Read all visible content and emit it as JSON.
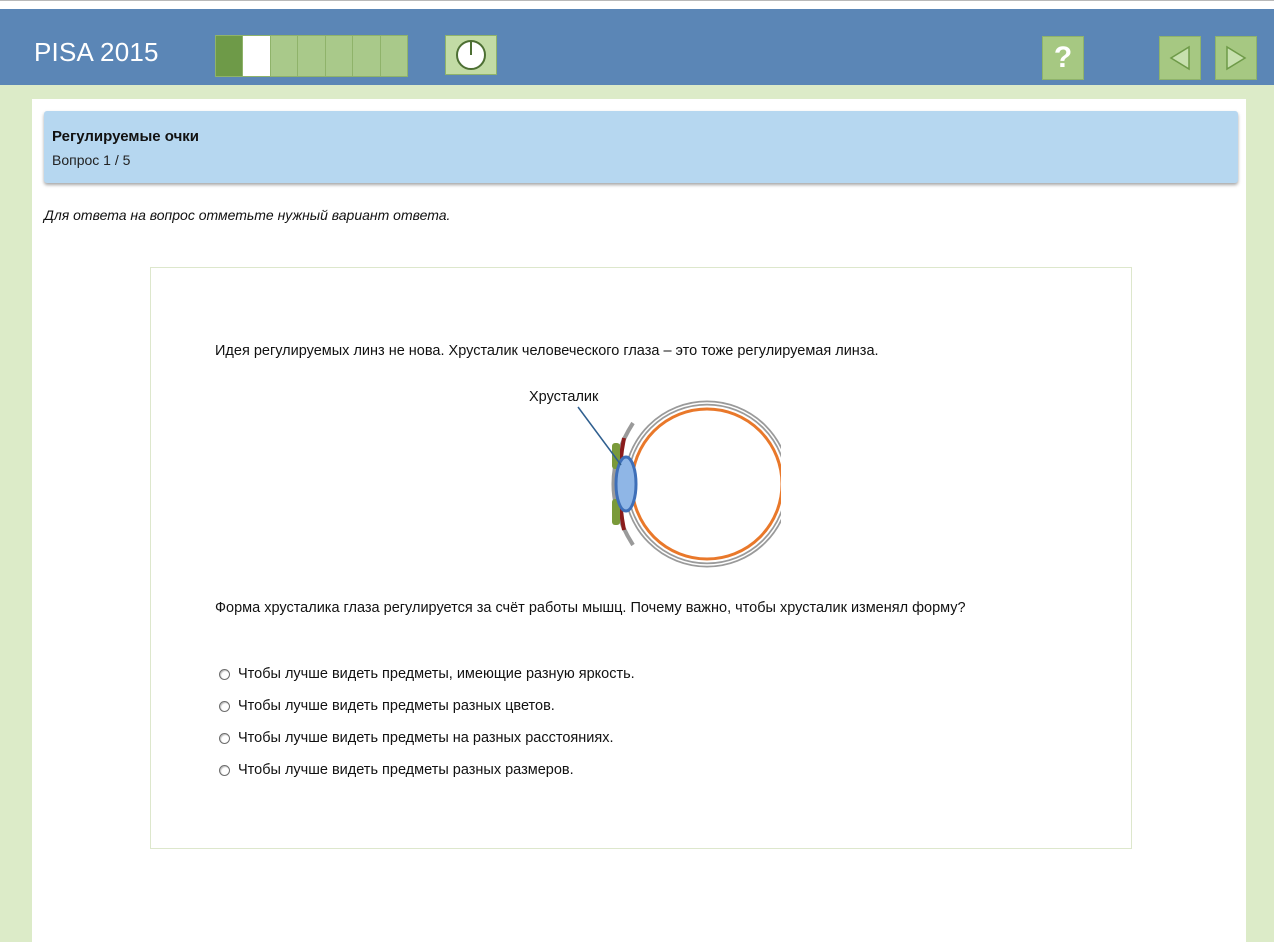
{
  "header": {
    "logo": "PISA 2015",
    "progress": {
      "segments": 7,
      "completed": 1,
      "current": 2
    },
    "timer_icon": "clock-icon",
    "help_label": "?",
    "nav": {
      "prev_icon": "arrow-left-icon",
      "next_icon": "arrow-right-icon"
    }
  },
  "unit": {
    "title": "Регулируемые очки",
    "question_number": "Вопрос 1 / 5"
  },
  "instruction": "Для ответа на вопрос отметьте нужный вариант ответа.",
  "content": {
    "intro": "Идея регулируемых линз не нова. Хрусталик человеческого глаза – это тоже регулируемая линза.",
    "figure": {
      "label": "Хрусталик"
    },
    "question": "Форма хрусталика глаза регулируется за счёт работы мышц. Почему важно, чтобы хрусталик изменял форму?",
    "options": [
      "Чтобы лучше видеть предметы, имеющие разную яркость.",
      "Чтобы лучше видеть предметы разных цветов.",
      "Чтобы лучше видеть предметы на разных расстояниях.",
      "Чтобы лучше видеть предметы разных размеров."
    ]
  },
  "colors": {
    "header_bg": "#5b86b6",
    "frame_bg": "#dcebc8",
    "title_bg": "#b6d7f0",
    "button_bg": "#a6c882"
  }
}
